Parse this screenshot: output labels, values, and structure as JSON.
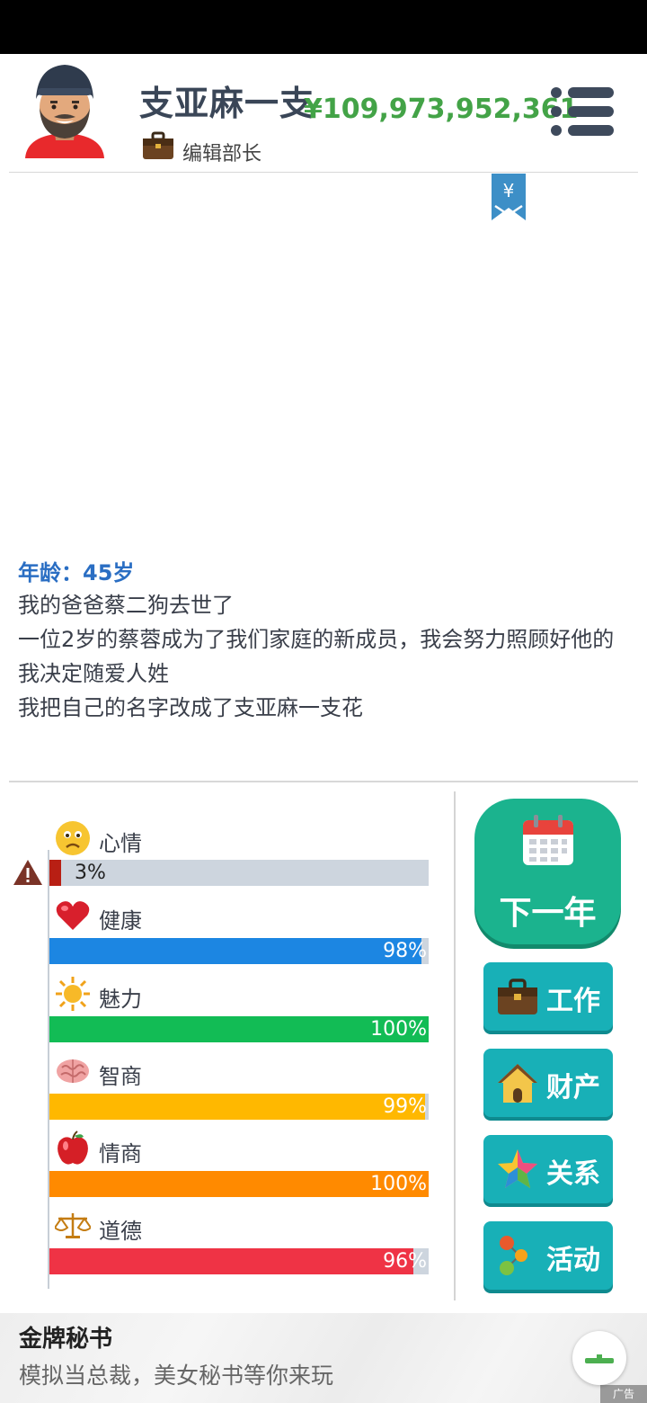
{
  "header": {
    "player_name": "支亚麻一支",
    "money": "¥109,973,952,361",
    "job_title": "编辑部长"
  },
  "bookmark_symbol": "¥",
  "log": {
    "age": "年龄：45岁",
    "lines": [
      "我的爸爸蔡二狗去世了",
      "一位2岁的蔡蓉成为了我们家庭的新成员，我会努力照顾好他的",
      "我决定随爱人姓",
      "我把自己的名字改成了支亚麻一支花"
    ]
  },
  "stats": [
    {
      "label": "心情",
      "value": 3,
      "display": "3%",
      "icon": "worried-face-icon",
      "color": "#b81f14"
    },
    {
      "label": "健康",
      "value": 98,
      "display": "98%",
      "icon": "heart-icon",
      "color": "#1c86e2"
    },
    {
      "label": "魅力",
      "value": 100,
      "display": "100%",
      "icon": "sun-icon",
      "color": "#12bc55"
    },
    {
      "label": "智商",
      "value": 99,
      "display": "99%",
      "icon": "brain-icon",
      "color": "#ffb800"
    },
    {
      "label": "情商",
      "value": 100,
      "display": "100%",
      "icon": "apple-icon",
      "color": "#ff8a00"
    },
    {
      "label": "道德",
      "value": 96,
      "display": "96%",
      "icon": "scales-icon",
      "color": "#ef3345"
    }
  ],
  "buttons": {
    "next_year": "下一年",
    "work": "工作",
    "property": "财产",
    "relations": "关系",
    "activities": "活动"
  },
  "ad": {
    "title": "金牌秘书",
    "subtitle": "模拟当总裁，美女秘书等你来玩",
    "badge": "广告"
  },
  "colors": {
    "money": "#43a347",
    "age": "#2a6ec3",
    "next_year_button": "#1bb38e",
    "side_button": "#18b0b7"
  }
}
